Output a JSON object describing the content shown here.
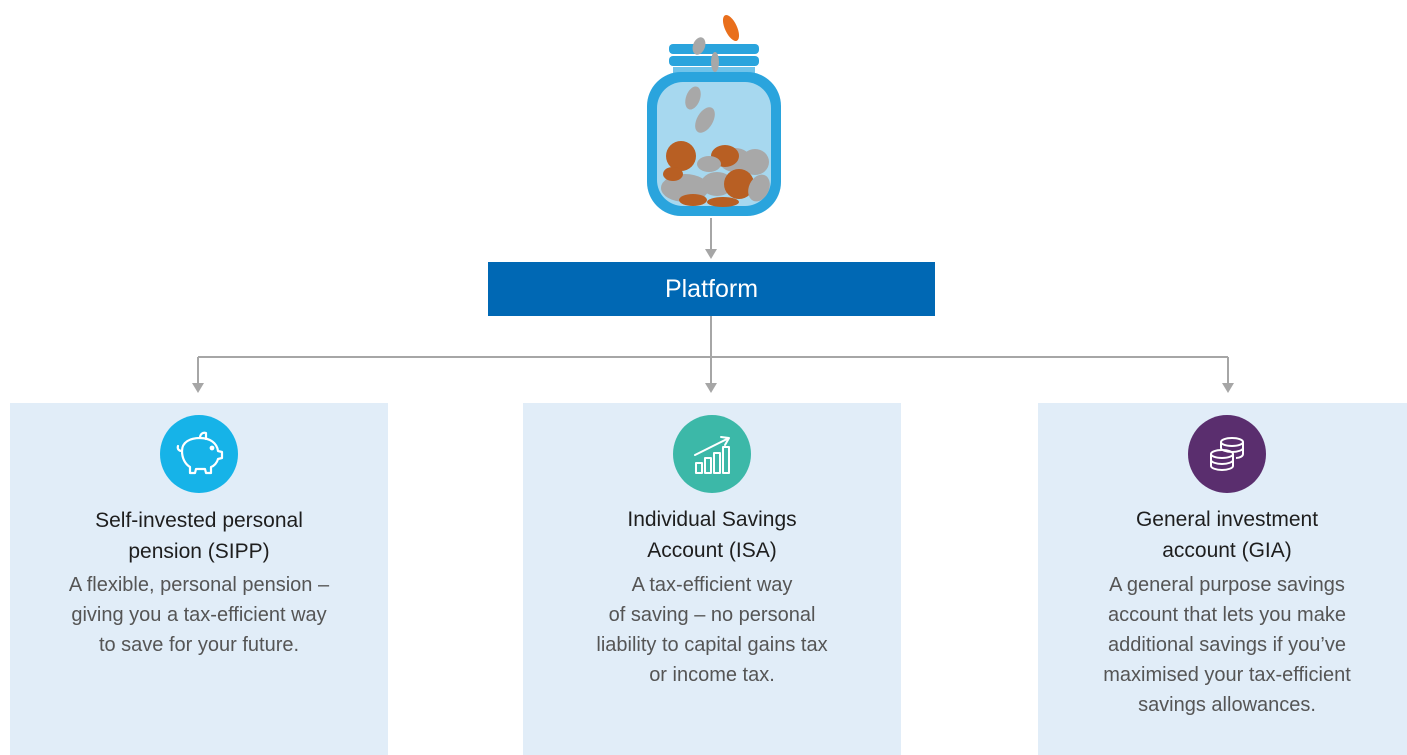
{
  "colors": {
    "platform": "#0068b4",
    "card_background": "#e1edf8",
    "connector": "#a6a6a6",
    "sipp_icon": "#16b3e8",
    "isa_icon": "#3cb8a8",
    "gia_icon": "#5a2e6e",
    "jar_rim": "#2aa4dd",
    "jar_glass": "#a7d8ef",
    "copper_coin": "#b85f23",
    "silver_coin": "#a8a8a8",
    "falling_coin": "#e96f1c"
  },
  "platform": {
    "label": "Platform"
  },
  "accounts": [
    {
      "icon": "piggy-bank-icon",
      "title_lines": [
        "Self-invested personal",
        "pension (SIPP)"
      ],
      "desc_lines": [
        "A flexible, personal pension –",
        "giving you a tax-efficient way",
        "to save for your future."
      ]
    },
    {
      "icon": "growth-chart-icon",
      "title_lines": [
        "Individual Savings",
        "Account (ISA)"
      ],
      "desc_lines": [
        "A tax-efficient way",
        "of saving – no personal",
        "liability to capital gains tax",
        "or income tax."
      ]
    },
    {
      "icon": "coin-stack-icon",
      "title_lines": [
        "General investment",
        "account (GIA)"
      ],
      "desc_lines": [
        "A general purpose savings",
        "account that lets you make",
        "additional savings if you’ve",
        "maximised your tax-efficient",
        "savings allowances."
      ]
    }
  ]
}
